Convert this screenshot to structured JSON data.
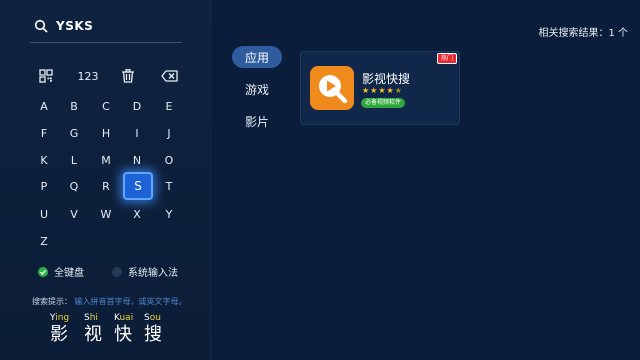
{
  "search": {
    "query": "YSKS"
  },
  "keyboard": {
    "function_keys": {
      "qr": "qr-code-icon",
      "numbers_label": "123",
      "trash": "trash-icon",
      "backspace": "backspace-icon"
    },
    "rows": [
      [
        "A",
        "B",
        "C",
        "D",
        "E"
      ],
      [
        "F",
        "G",
        "H",
        "I",
        "J"
      ],
      [
        "K",
        "L",
        "M",
        "N",
        "O"
      ],
      [
        "P",
        "Q",
        "R",
        "S",
        "T"
      ],
      [
        "U",
        "V",
        "W",
        "X",
        "Y"
      ],
      [
        "Z"
      ]
    ],
    "selected_key": "S"
  },
  "input_modes": [
    {
      "label": "全键盘",
      "selected": true
    },
    {
      "label": "系统输入法",
      "selected": false
    }
  ],
  "hint": {
    "label": "搜索提示：",
    "text": "输入拼音首字母，或英文字母。"
  },
  "pinyin_example": [
    {
      "pinyin": "Ying",
      "initial": "Y",
      "rest": "ing",
      "char": "影"
    },
    {
      "pinyin": "Shi",
      "initial": "S",
      "rest": "hi",
      "char": "视"
    },
    {
      "pinyin": "Kuai",
      "initial": "K",
      "rest": "uai",
      "char": "快"
    },
    {
      "pinyin": "Sou",
      "initial": "S",
      "rest": "ou",
      "char": "搜"
    }
  ],
  "tabs": [
    {
      "label": "应用",
      "active": true
    },
    {
      "label": "游戏",
      "active": false
    },
    {
      "label": "影片",
      "active": false
    }
  ],
  "results_summary": "相关搜索结果：1 个",
  "results": [
    {
      "name": "影视快搜",
      "rating": 4.5,
      "tag": "必备视频软件",
      "badge": "热门",
      "icon": "play-magnifier-icon",
      "icon_color": "#f18a1c"
    }
  ],
  "colors": {
    "background": "#0a1d3a",
    "accent": "#1d63d6",
    "pinyin": "#f0d43a",
    "hot": "#e8262d",
    "tag": "#2fa63c"
  }
}
